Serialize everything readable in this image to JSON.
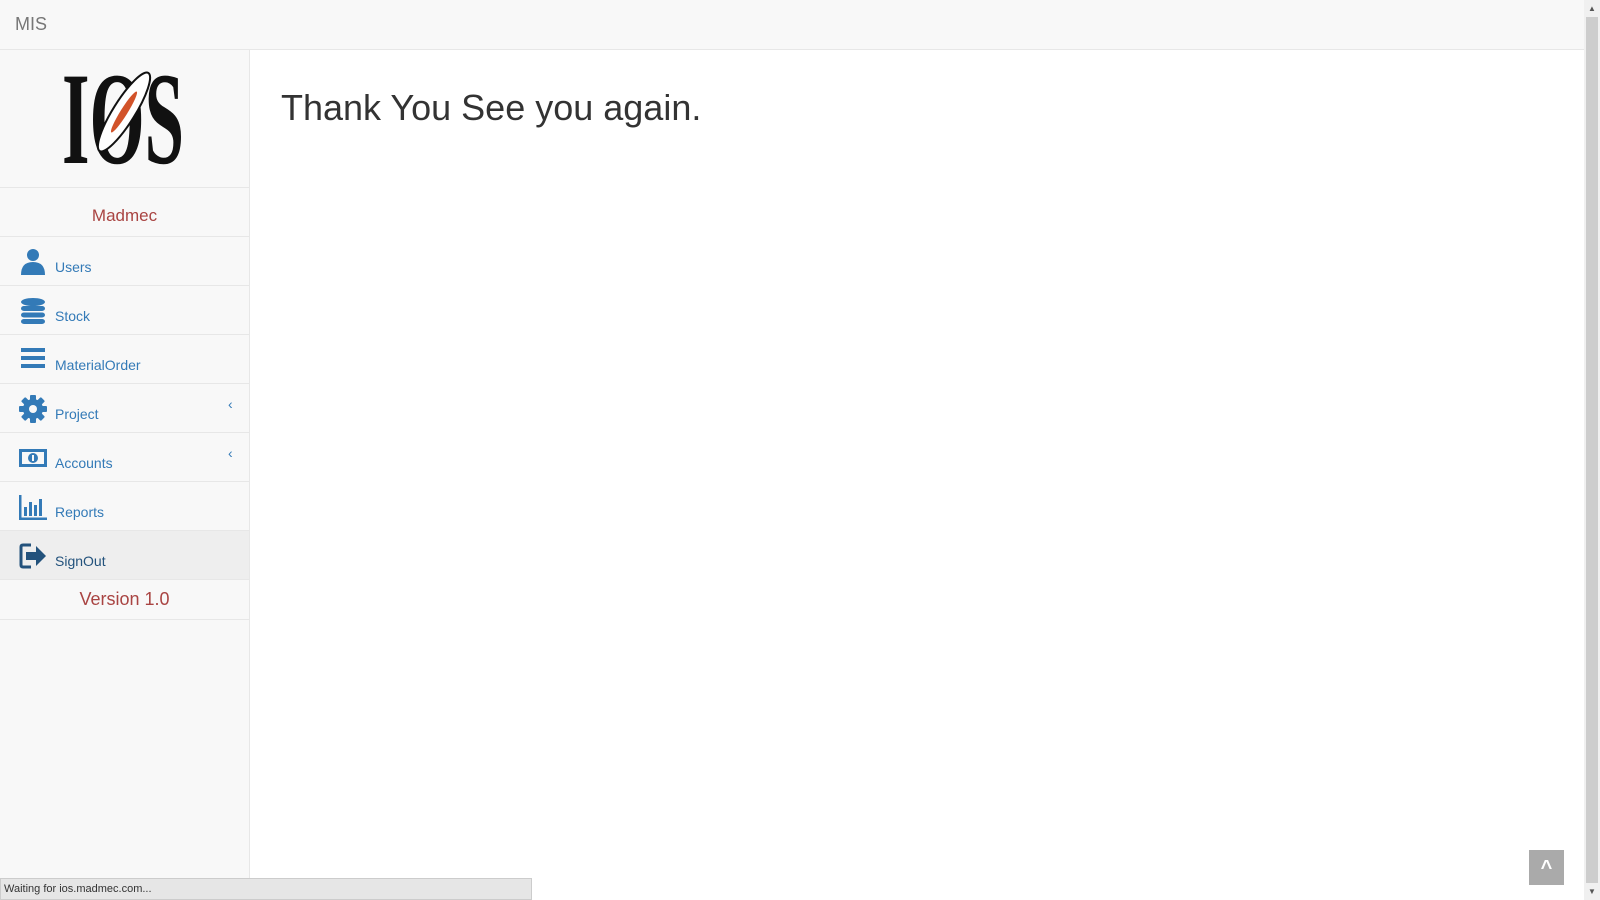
{
  "header": {
    "brand": "MIS"
  },
  "sidebar": {
    "company": "Madmec",
    "items": [
      {
        "label": "Users",
        "icon": "user-icon"
      },
      {
        "label": "Stock",
        "icon": "database-icon"
      },
      {
        "label": "MaterialOrder",
        "icon": "list-icon"
      },
      {
        "label": "Project",
        "icon": "gear-icon",
        "arrow": "‹"
      },
      {
        "label": "Accounts",
        "icon": "money-icon",
        "arrow": "‹"
      },
      {
        "label": "Reports",
        "icon": "bar-chart-icon"
      },
      {
        "label": "SignOut",
        "icon": "sign-out-icon"
      }
    ],
    "version": "Version 1.0"
  },
  "main": {
    "title": "Thank You See you again."
  },
  "status": {
    "text": "Waiting for ios.madmec.com..."
  },
  "scroll_top": {
    "label": "^"
  },
  "colors": {
    "accent": "#337ab7",
    "brand_red": "#a94442",
    "sidebar_bg": "#f8f8f8",
    "border": "#e7e7e7"
  }
}
